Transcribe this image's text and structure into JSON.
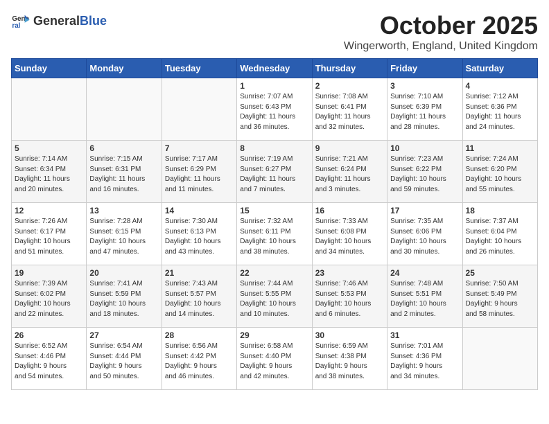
{
  "header": {
    "logo_general": "General",
    "logo_blue": "Blue",
    "month": "October 2025",
    "location": "Wingerworth, England, United Kingdom"
  },
  "days_of_week": [
    "Sunday",
    "Monday",
    "Tuesday",
    "Wednesday",
    "Thursday",
    "Friday",
    "Saturday"
  ],
  "weeks": [
    [
      {
        "day": "",
        "info": ""
      },
      {
        "day": "",
        "info": ""
      },
      {
        "day": "",
        "info": ""
      },
      {
        "day": "1",
        "info": "Sunrise: 7:07 AM\nSunset: 6:43 PM\nDaylight: 11 hours\nand 36 minutes."
      },
      {
        "day": "2",
        "info": "Sunrise: 7:08 AM\nSunset: 6:41 PM\nDaylight: 11 hours\nand 32 minutes."
      },
      {
        "day": "3",
        "info": "Sunrise: 7:10 AM\nSunset: 6:39 PM\nDaylight: 11 hours\nand 28 minutes."
      },
      {
        "day": "4",
        "info": "Sunrise: 7:12 AM\nSunset: 6:36 PM\nDaylight: 11 hours\nand 24 minutes."
      }
    ],
    [
      {
        "day": "5",
        "info": "Sunrise: 7:14 AM\nSunset: 6:34 PM\nDaylight: 11 hours\nand 20 minutes."
      },
      {
        "day": "6",
        "info": "Sunrise: 7:15 AM\nSunset: 6:31 PM\nDaylight: 11 hours\nand 16 minutes."
      },
      {
        "day": "7",
        "info": "Sunrise: 7:17 AM\nSunset: 6:29 PM\nDaylight: 11 hours\nand 11 minutes."
      },
      {
        "day": "8",
        "info": "Sunrise: 7:19 AM\nSunset: 6:27 PM\nDaylight: 11 hours\nand 7 minutes."
      },
      {
        "day": "9",
        "info": "Sunrise: 7:21 AM\nSunset: 6:24 PM\nDaylight: 11 hours\nand 3 minutes."
      },
      {
        "day": "10",
        "info": "Sunrise: 7:23 AM\nSunset: 6:22 PM\nDaylight: 10 hours\nand 59 minutes."
      },
      {
        "day": "11",
        "info": "Sunrise: 7:24 AM\nSunset: 6:20 PM\nDaylight: 10 hours\nand 55 minutes."
      }
    ],
    [
      {
        "day": "12",
        "info": "Sunrise: 7:26 AM\nSunset: 6:17 PM\nDaylight: 10 hours\nand 51 minutes."
      },
      {
        "day": "13",
        "info": "Sunrise: 7:28 AM\nSunset: 6:15 PM\nDaylight: 10 hours\nand 47 minutes."
      },
      {
        "day": "14",
        "info": "Sunrise: 7:30 AM\nSunset: 6:13 PM\nDaylight: 10 hours\nand 43 minutes."
      },
      {
        "day": "15",
        "info": "Sunrise: 7:32 AM\nSunset: 6:11 PM\nDaylight: 10 hours\nand 38 minutes."
      },
      {
        "day": "16",
        "info": "Sunrise: 7:33 AM\nSunset: 6:08 PM\nDaylight: 10 hours\nand 34 minutes."
      },
      {
        "day": "17",
        "info": "Sunrise: 7:35 AM\nSunset: 6:06 PM\nDaylight: 10 hours\nand 30 minutes."
      },
      {
        "day": "18",
        "info": "Sunrise: 7:37 AM\nSunset: 6:04 PM\nDaylight: 10 hours\nand 26 minutes."
      }
    ],
    [
      {
        "day": "19",
        "info": "Sunrise: 7:39 AM\nSunset: 6:02 PM\nDaylight: 10 hours\nand 22 minutes."
      },
      {
        "day": "20",
        "info": "Sunrise: 7:41 AM\nSunset: 5:59 PM\nDaylight: 10 hours\nand 18 minutes."
      },
      {
        "day": "21",
        "info": "Sunrise: 7:43 AM\nSunset: 5:57 PM\nDaylight: 10 hours\nand 14 minutes."
      },
      {
        "day": "22",
        "info": "Sunrise: 7:44 AM\nSunset: 5:55 PM\nDaylight: 10 hours\nand 10 minutes."
      },
      {
        "day": "23",
        "info": "Sunrise: 7:46 AM\nSunset: 5:53 PM\nDaylight: 10 hours\nand 6 minutes."
      },
      {
        "day": "24",
        "info": "Sunrise: 7:48 AM\nSunset: 5:51 PM\nDaylight: 10 hours\nand 2 minutes."
      },
      {
        "day": "25",
        "info": "Sunrise: 7:50 AM\nSunset: 5:49 PM\nDaylight: 9 hours\nand 58 minutes."
      }
    ],
    [
      {
        "day": "26",
        "info": "Sunrise: 6:52 AM\nSunset: 4:46 PM\nDaylight: 9 hours\nand 54 minutes."
      },
      {
        "day": "27",
        "info": "Sunrise: 6:54 AM\nSunset: 4:44 PM\nDaylight: 9 hours\nand 50 minutes."
      },
      {
        "day": "28",
        "info": "Sunrise: 6:56 AM\nSunset: 4:42 PM\nDaylight: 9 hours\nand 46 minutes."
      },
      {
        "day": "29",
        "info": "Sunrise: 6:58 AM\nSunset: 4:40 PM\nDaylight: 9 hours\nand 42 minutes."
      },
      {
        "day": "30",
        "info": "Sunrise: 6:59 AM\nSunset: 4:38 PM\nDaylight: 9 hours\nand 38 minutes."
      },
      {
        "day": "31",
        "info": "Sunrise: 7:01 AM\nSunset: 4:36 PM\nDaylight: 9 hours\nand 34 minutes."
      },
      {
        "day": "",
        "info": ""
      }
    ]
  ]
}
